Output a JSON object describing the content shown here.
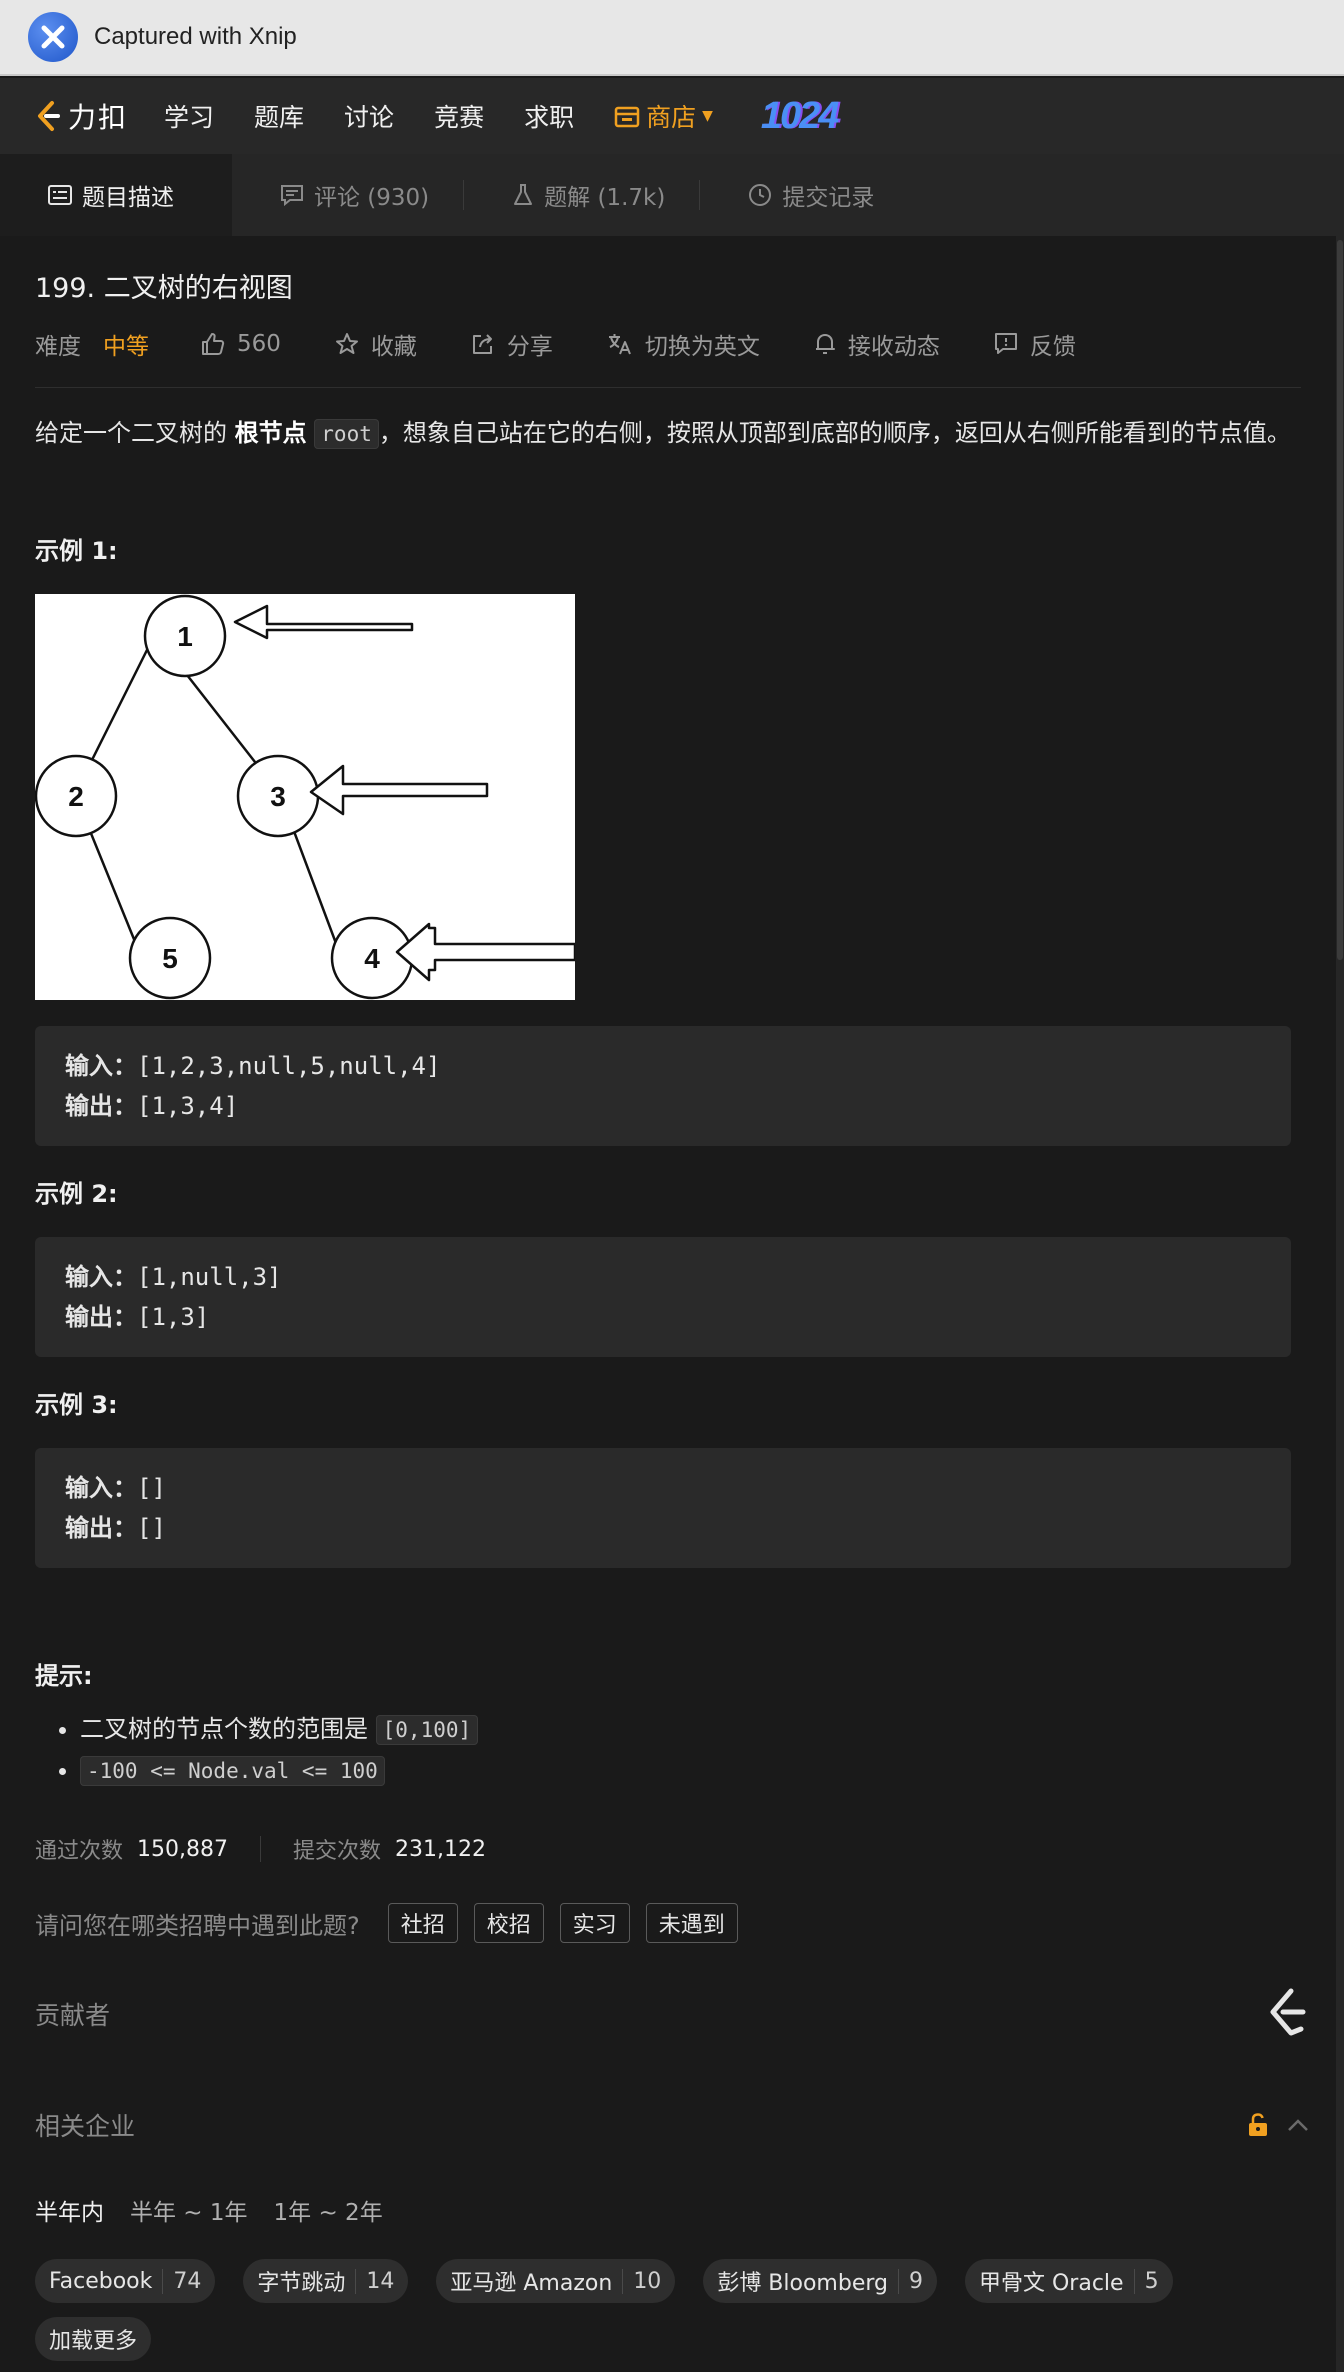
{
  "capture_bar": {
    "title": "Captured with Xnip"
  },
  "nav": {
    "brand": "力扣",
    "items": [
      "学习",
      "题库",
      "讨论",
      "竞赛",
      "求职"
    ],
    "store": "商店",
    "badge": "1024"
  },
  "tabs": [
    {
      "label": "题目描述",
      "icon": "description-icon",
      "active": true
    },
    {
      "label": "评论 (930)",
      "icon": "comment-icon",
      "active": false
    },
    {
      "label": "题解 (1.7k)",
      "icon": "flask-icon",
      "active": false
    },
    {
      "label": "提交记录",
      "icon": "clock-icon",
      "active": false
    }
  ],
  "problem": {
    "title": "199. 二叉树的右视图",
    "difficulty_label": "难度",
    "difficulty": "中等",
    "likes": "560",
    "actions": [
      "收藏",
      "分享",
      "切换为英文",
      "接收动态",
      "反馈"
    ],
    "desc_part1": "给定一个二叉树的 ",
    "desc_bold": "根节点",
    "desc_code": "root",
    "desc_part2": "，想象自己站在它的右侧，按照从顶部到底部的顺序，返回从右侧所能看到的节点值。"
  },
  "examples": [
    {
      "title": "示例 1:",
      "input_label": "输入：",
      "input": "[1,2,3,null,5,null,4]",
      "output_label": "输出：",
      "output": "[1,3,4]"
    },
    {
      "title": "示例 2:",
      "input_label": "输入：",
      "input": "[1,null,3]",
      "output_label": "输出：",
      "output": "[1,3]"
    },
    {
      "title": "示例 3:",
      "input_label": "输入：",
      "input": "[]",
      "output_label": "输出：",
      "output": "[]"
    }
  ],
  "tree_labels": {
    "n1": "1",
    "n2": "2",
    "n3": "3",
    "n4": "4",
    "n5": "5"
  },
  "hints": {
    "title": "提示:",
    "h1_text": "二叉树的节点个数的范围是 ",
    "h1_code": "[0,100]",
    "h2_code": "-100 <= Node.val <= 100"
  },
  "stats": {
    "pass_label": "通过次数",
    "pass": "150,887",
    "submit_label": "提交次数",
    "submit": "231,122"
  },
  "survey": {
    "question": "请问您在哪类招聘中遇到此题?",
    "options": [
      "社招",
      "校招",
      "实习",
      "未遇到"
    ]
  },
  "contributors": {
    "title": "贡献者"
  },
  "companies": {
    "title": "相关企业",
    "periods": [
      "半年内",
      "半年 ~ 1年",
      "1年 ~ 2年"
    ],
    "list": [
      {
        "name": "Facebook",
        "count": "74"
      },
      {
        "name": "字节跳动",
        "count": "14"
      },
      {
        "name": "亚马逊 Amazon",
        "count": "10"
      },
      {
        "name": "彭博 Bloomberg",
        "count": "9"
      },
      {
        "name": "甲骨文 Oracle",
        "count": "5"
      }
    ],
    "more": "加载更多"
  },
  "colors": {
    "accent": "#f0a020",
    "bg": "#1a1a1a",
    "panel": "#2a2a2a"
  }
}
